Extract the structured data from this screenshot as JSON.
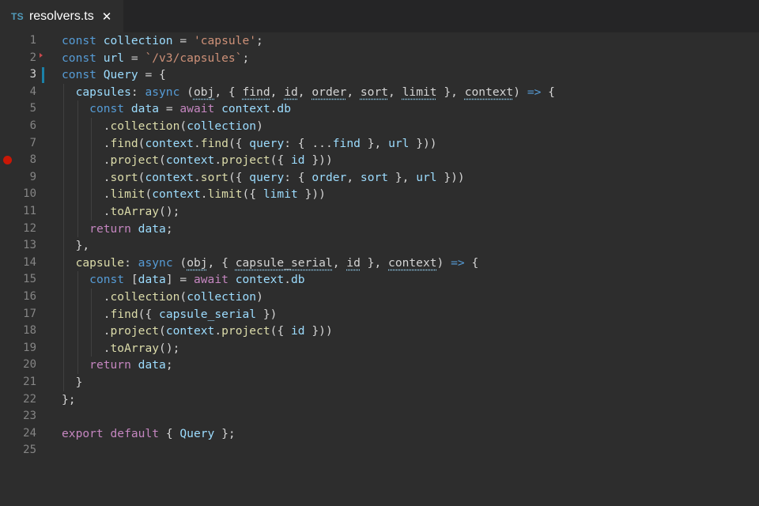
{
  "tab": {
    "lang": "TS",
    "filename": "resolvers.ts",
    "close_icon": "✕"
  },
  "editor": {
    "active_line": 3,
    "breakpoint_line": 8,
    "lines": [
      {
        "n": "1",
        "tokens": [
          [
            "kw2",
            "const "
          ],
          [
            "prop",
            "collection"
          ],
          [
            "op",
            " = "
          ],
          [
            "str",
            "'capsule'"
          ],
          [
            "op",
            ";"
          ]
        ]
      },
      {
        "n": "2",
        "tokens": [
          [
            "kw2",
            "const "
          ],
          [
            "prop",
            "url"
          ],
          [
            "op",
            " = "
          ],
          [
            "str",
            "`/v3/capsules`"
          ],
          [
            "op",
            ";"
          ]
        ]
      },
      {
        "n": "3",
        "tokens": [
          [
            "kw2",
            "const "
          ],
          [
            "prop",
            "Query"
          ],
          [
            "op",
            " = {"
          ]
        ]
      },
      {
        "n": "4",
        "tokens": [
          [
            "op",
            "  "
          ],
          [
            "prop",
            "capsules"
          ],
          [
            "op",
            ": "
          ],
          [
            "kw2",
            "async "
          ],
          [
            "op",
            "("
          ],
          [
            "hint",
            "obj"
          ],
          [
            "op",
            ", { "
          ],
          [
            "hint",
            "find"
          ],
          [
            "op",
            ", "
          ],
          [
            "hint",
            "id"
          ],
          [
            "op",
            ", "
          ],
          [
            "hint",
            "order"
          ],
          [
            "op",
            ", "
          ],
          [
            "hint",
            "sort"
          ],
          [
            "op",
            ", "
          ],
          [
            "hint",
            "limit"
          ],
          [
            "op",
            " }, "
          ],
          [
            "hint",
            "context"
          ],
          [
            "op",
            ") "
          ],
          [
            "kw2",
            "=>"
          ],
          [
            "op",
            " {"
          ]
        ]
      },
      {
        "n": "5",
        "tokens": [
          [
            "op",
            "    "
          ],
          [
            "kw2",
            "const "
          ],
          [
            "prop",
            "data"
          ],
          [
            "op",
            " = "
          ],
          [
            "kw",
            "await "
          ],
          [
            "prop",
            "context"
          ],
          [
            "op",
            "."
          ],
          [
            "prop",
            "db"
          ]
        ]
      },
      {
        "n": "6",
        "tokens": [
          [
            "op",
            "      ."
          ],
          [
            "fn",
            "collection"
          ],
          [
            "op",
            "("
          ],
          [
            "prop",
            "collection"
          ],
          [
            "op",
            ")"
          ]
        ]
      },
      {
        "n": "7",
        "tokens": [
          [
            "op",
            "      ."
          ],
          [
            "fn",
            "find"
          ],
          [
            "op",
            "("
          ],
          [
            "prop",
            "context"
          ],
          [
            "op",
            "."
          ],
          [
            "fn",
            "find"
          ],
          [
            "op",
            "({ "
          ],
          [
            "prop",
            "query"
          ],
          [
            "op",
            ": { ..."
          ],
          [
            "prop",
            "find"
          ],
          [
            "op",
            " }, "
          ],
          [
            "prop",
            "url"
          ],
          [
            "op",
            " }))"
          ]
        ]
      },
      {
        "n": "8",
        "tokens": [
          [
            "op",
            "      ."
          ],
          [
            "fn",
            "project"
          ],
          [
            "op",
            "("
          ],
          [
            "prop",
            "context"
          ],
          [
            "op",
            "."
          ],
          [
            "fn",
            "project"
          ],
          [
            "op",
            "({ "
          ],
          [
            "prop",
            "id"
          ],
          [
            "op",
            " }))"
          ]
        ]
      },
      {
        "n": "9",
        "tokens": [
          [
            "op",
            "      ."
          ],
          [
            "fn",
            "sort"
          ],
          [
            "op",
            "("
          ],
          [
            "prop",
            "context"
          ],
          [
            "op",
            "."
          ],
          [
            "fn",
            "sort"
          ],
          [
            "op",
            "({ "
          ],
          [
            "prop",
            "query"
          ],
          [
            "op",
            ": { "
          ],
          [
            "prop",
            "order"
          ],
          [
            "op",
            ", "
          ],
          [
            "prop",
            "sort"
          ],
          [
            "op",
            " }, "
          ],
          [
            "prop",
            "url"
          ],
          [
            "op",
            " }))"
          ]
        ]
      },
      {
        "n": "10",
        "tokens": [
          [
            "op",
            "      ."
          ],
          [
            "fn",
            "limit"
          ],
          [
            "op",
            "("
          ],
          [
            "prop",
            "context"
          ],
          [
            "op",
            "."
          ],
          [
            "fn",
            "limit"
          ],
          [
            "op",
            "({ "
          ],
          [
            "prop",
            "limit"
          ],
          [
            "op",
            " }))"
          ]
        ]
      },
      {
        "n": "11",
        "tokens": [
          [
            "op",
            "      ."
          ],
          [
            "fn",
            "toArray"
          ],
          [
            "op",
            "();"
          ]
        ]
      },
      {
        "n": "12",
        "tokens": [
          [
            "op",
            "    "
          ],
          [
            "kw",
            "return "
          ],
          [
            "prop",
            "data"
          ],
          [
            "op",
            ";"
          ]
        ]
      },
      {
        "n": "13",
        "tokens": [
          [
            "op",
            "  },"
          ]
        ]
      },
      {
        "n": "14",
        "tokens": [
          [
            "op",
            "  "
          ],
          [
            "fn",
            "capsule"
          ],
          [
            "op",
            ": "
          ],
          [
            "kw2",
            "async "
          ],
          [
            "op",
            "("
          ],
          [
            "hint",
            "obj"
          ],
          [
            "op",
            ", { "
          ],
          [
            "hint",
            "capsule_serial"
          ],
          [
            "op",
            ", "
          ],
          [
            "hint",
            "id"
          ],
          [
            "op",
            " }, "
          ],
          [
            "hint",
            "context"
          ],
          [
            "op",
            ") "
          ],
          [
            "kw2",
            "=>"
          ],
          [
            "op",
            " {"
          ]
        ]
      },
      {
        "n": "15",
        "tokens": [
          [
            "op",
            "    "
          ],
          [
            "kw2",
            "const "
          ],
          [
            "op",
            "["
          ],
          [
            "prop",
            "data"
          ],
          [
            "op",
            "] = "
          ],
          [
            "kw",
            "await "
          ],
          [
            "prop",
            "context"
          ],
          [
            "op",
            "."
          ],
          [
            "prop",
            "db"
          ]
        ]
      },
      {
        "n": "16",
        "tokens": [
          [
            "op",
            "      ."
          ],
          [
            "fn",
            "collection"
          ],
          [
            "op",
            "("
          ],
          [
            "prop",
            "collection"
          ],
          [
            "op",
            ")"
          ]
        ]
      },
      {
        "n": "17",
        "tokens": [
          [
            "op",
            "      ."
          ],
          [
            "fn",
            "find"
          ],
          [
            "op",
            "({ "
          ],
          [
            "prop",
            "capsule_serial"
          ],
          [
            "op",
            " })"
          ]
        ]
      },
      {
        "n": "18",
        "tokens": [
          [
            "op",
            "      ."
          ],
          [
            "fn",
            "project"
          ],
          [
            "op",
            "("
          ],
          [
            "prop",
            "context"
          ],
          [
            "op",
            "."
          ],
          [
            "fn",
            "project"
          ],
          [
            "op",
            "({ "
          ],
          [
            "prop",
            "id"
          ],
          [
            "op",
            " }))"
          ]
        ]
      },
      {
        "n": "19",
        "tokens": [
          [
            "op",
            "      ."
          ],
          [
            "fn",
            "toArray"
          ],
          [
            "op",
            "();"
          ]
        ]
      },
      {
        "n": "20",
        "tokens": [
          [
            "op",
            "    "
          ],
          [
            "kw",
            "return "
          ],
          [
            "prop",
            "data"
          ],
          [
            "op",
            ";"
          ]
        ]
      },
      {
        "n": "21",
        "tokens": [
          [
            "op",
            "  }"
          ]
        ]
      },
      {
        "n": "22",
        "tokens": [
          [
            "op",
            "};"
          ]
        ]
      },
      {
        "n": "23",
        "tokens": []
      },
      {
        "n": "24",
        "tokens": [
          [
            "kw",
            "export "
          ],
          [
            "kw",
            "default "
          ],
          [
            "op",
            "{ "
          ],
          [
            "prop",
            "Query"
          ],
          [
            "op",
            " };"
          ]
        ]
      },
      {
        "n": "25",
        "tokens": []
      }
    ]
  }
}
